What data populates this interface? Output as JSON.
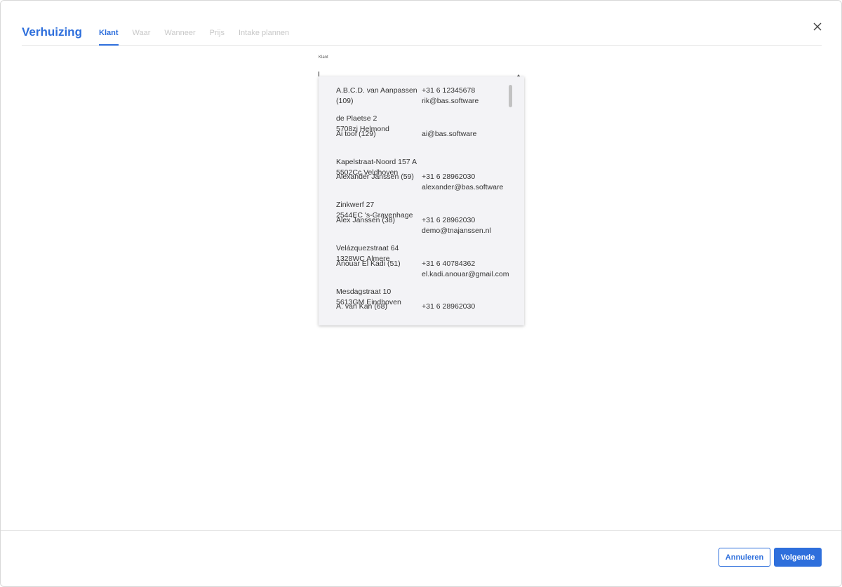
{
  "dialog": {
    "title": "Verhuizing",
    "tabs": [
      {
        "label": "Klant",
        "active": true
      },
      {
        "label": "Waar",
        "active": false
      },
      {
        "label": "Wanneer",
        "active": false
      },
      {
        "label": "Prijs",
        "active": false
      },
      {
        "label": "Intake plannen",
        "active": false
      }
    ],
    "close_icon": "close-icon"
  },
  "field": {
    "label": "Klant",
    "value": "",
    "placeholder": ""
  },
  "dropdown": {
    "options": [
      {
        "name": [
          "A.B.C.D. van Aanpassen",
          "(109)"
        ],
        "address": [
          "de Plaetse 2",
          "5708zj Helmond"
        ],
        "contact": [
          "+31 6 12345678",
          "rik@bas.software"
        ]
      },
      {
        "name": [
          "Ai tool (129)"
        ],
        "address": [
          "Kapelstraat-Noord 157 A",
          "5502Cc Veldhoven"
        ],
        "contact": [
          "ai@bas.software"
        ]
      },
      {
        "name": [
          "Alexander Janssen (59)"
        ],
        "address": [
          "Zinkwerf 27",
          "2544EC 's-Gravenhage"
        ],
        "contact": [
          "+31 6 28962030",
          "alexander@bas.software"
        ]
      },
      {
        "name": [
          "Alex Janssen (38)"
        ],
        "address": [
          "Velázquezstraat 64",
          "1328WC Almere"
        ],
        "contact": [
          "+31 6 28962030",
          "demo@tnajanssen.nl"
        ]
      },
      {
        "name": [
          "Anouar El Kadi (51)"
        ],
        "address": [
          "Mesdagstraat 10",
          "5613GM Eindhoven"
        ],
        "contact": [
          "+31 6 40784362",
          "el.kadi.anouar@gmail.com"
        ]
      },
      {
        "name": [
          "A. van Kan (68)"
        ],
        "address": [],
        "contact": [
          "+31 6 28962030"
        ]
      }
    ]
  },
  "footer": {
    "cancel_label": "Annuleren",
    "next_label": "Volgende"
  },
  "colors": {
    "accent": "#2e6fdc"
  }
}
